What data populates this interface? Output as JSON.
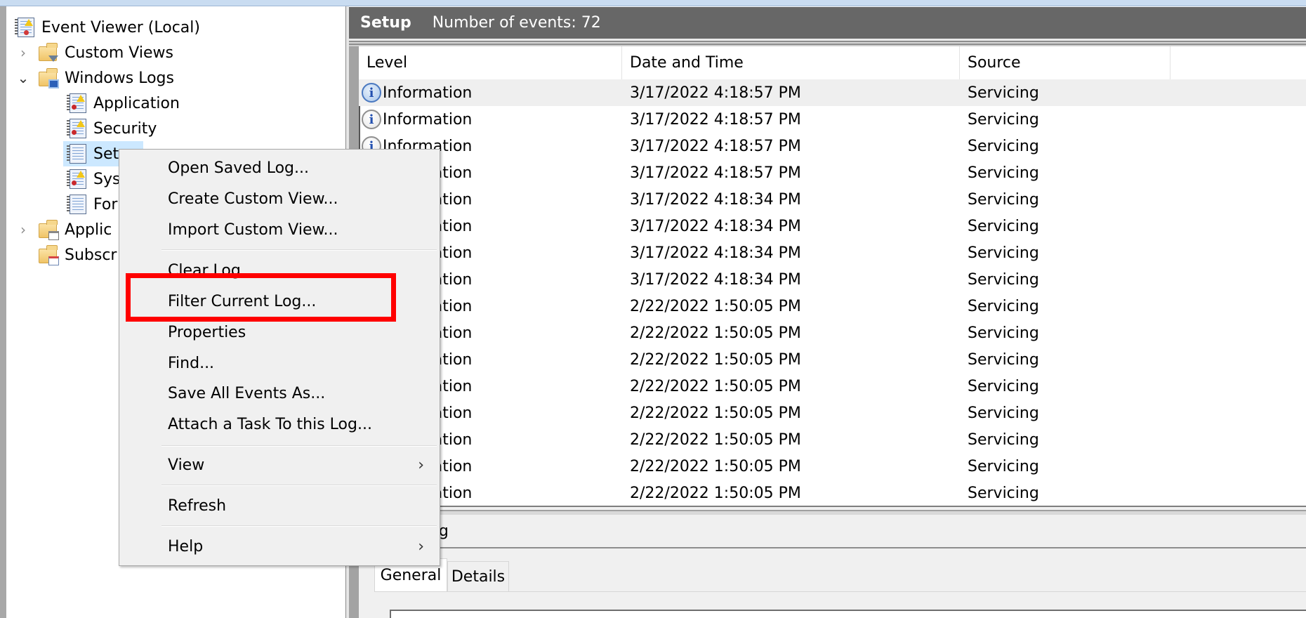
{
  "tree": {
    "root": {
      "label": "Event Viewer (Local)",
      "icon": "event-viewer-icon"
    },
    "items": [
      {
        "label": "Custom Views",
        "icon": "custom-views-folder-icon",
        "twisty": "collapsed"
      },
      {
        "label": "Windows Logs",
        "icon": "windows-logs-folder-icon",
        "twisty": "expanded"
      },
      {
        "label": "Application",
        "icon": "log-warning-icon"
      },
      {
        "label": "Security",
        "icon": "log-warning-icon"
      },
      {
        "label": "Setup",
        "icon": "log-icon",
        "selected": true
      },
      {
        "label": "Sys",
        "icon": "log-warning-icon"
      },
      {
        "label": "For",
        "icon": "log-icon"
      },
      {
        "label": "Applic",
        "icon": "applications-folder-icon",
        "twisty": "collapsed"
      },
      {
        "label": "Subscr",
        "icon": "subscriptions-folder-icon"
      }
    ],
    "twisty_collapsed": "›",
    "twisty_expanded": "⌄"
  },
  "log_header": {
    "title": "Setup",
    "count_text": "Number of events: 72"
  },
  "table": {
    "columns": [
      "Level",
      "Date and Time",
      "Source"
    ],
    "rows": [
      {
        "level": "Information",
        "datetime": "3/17/2022 4:18:57 PM",
        "source": "Servicing",
        "selected": true
      },
      {
        "level": "Information",
        "datetime": "3/17/2022 4:18:57 PM",
        "source": "Servicing"
      },
      {
        "level": "Information",
        "datetime": "3/17/2022 4:18:57 PM",
        "source": "Servicing"
      },
      {
        "level": "Information",
        "datetime": "3/17/2022 4:18:57 PM",
        "source": "Servicing"
      },
      {
        "level": "Information",
        "datetime": "3/17/2022 4:18:34 PM",
        "source": "Servicing"
      },
      {
        "level": "Information",
        "datetime": "3/17/2022 4:18:34 PM",
        "source": "Servicing"
      },
      {
        "level": "Information",
        "datetime": "3/17/2022 4:18:34 PM",
        "source": "Servicing"
      },
      {
        "level": "Information",
        "datetime": "3/17/2022 4:18:34 PM",
        "source": "Servicing"
      },
      {
        "level": "Information",
        "datetime": "2/22/2022 1:50:05 PM",
        "source": "Servicing"
      },
      {
        "level": "Information",
        "datetime": "2/22/2022 1:50:05 PM",
        "source": "Servicing"
      },
      {
        "level": "Information",
        "datetime": "2/22/2022 1:50:05 PM",
        "source": "Servicing"
      },
      {
        "level": "Information",
        "datetime": "2/22/2022 1:50:05 PM",
        "source": "Servicing"
      },
      {
        "level": "Information",
        "datetime": "2/22/2022 1:50:05 PM",
        "source": "Servicing"
      },
      {
        "level": "Information",
        "datetime": "2/22/2022 1:50:05 PM",
        "source": "Servicing"
      },
      {
        "level": "Information",
        "datetime": "2/22/2022 1:50:05 PM",
        "source": "Servicing"
      },
      {
        "level": "Information",
        "datetime": "2/22/2022 1:50:05 PM",
        "source": "Servicing"
      }
    ],
    "info_glyph": "i"
  },
  "detail": {
    "title_visible": "ervicing",
    "tabs": [
      "General",
      "Details"
    ],
    "active_tab": "General"
  },
  "context_menu": {
    "items": [
      {
        "label": "Open Saved Log..."
      },
      {
        "label": "Create Custom View..."
      },
      {
        "label": "Import Custom View..."
      },
      {
        "separator": true
      },
      {
        "label": "Clear Log..."
      },
      {
        "label": "Filter Current Log...",
        "highlighted": true
      },
      {
        "label": "Properties"
      },
      {
        "label": "Find..."
      },
      {
        "label": "Save All Events As..."
      },
      {
        "label": "Attach a Task To this Log..."
      },
      {
        "separator": true
      },
      {
        "label": "View",
        "submenu": true
      },
      {
        "separator": true
      },
      {
        "label": "Refresh"
      },
      {
        "separator": true
      },
      {
        "label": "Help",
        "submenu": true
      }
    ],
    "submenu_arrow": "›"
  },
  "annotation": {
    "color": "#ff0000",
    "target": "Filter Current Log..."
  }
}
